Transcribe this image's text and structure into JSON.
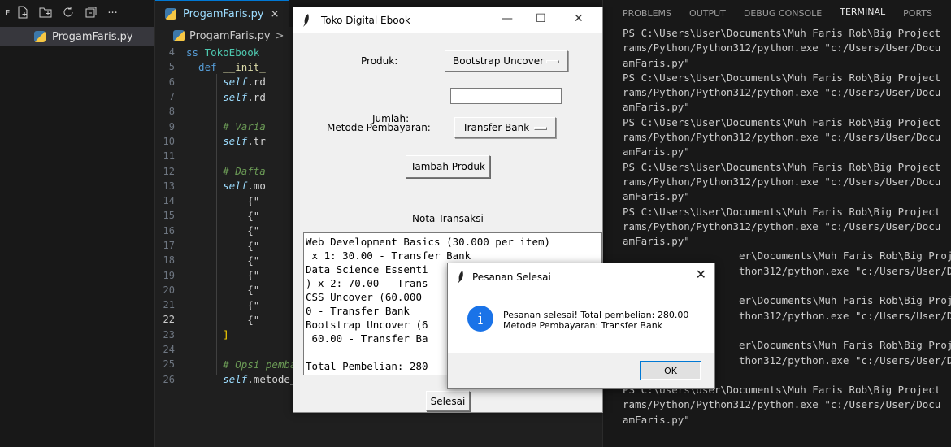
{
  "explorer": {
    "header_letter": "E",
    "file_name": "ProgamFaris.py"
  },
  "editor": {
    "tab_label": "ProgamFaris.py",
    "tab_close": "×",
    "breadcrumb_file": "ProgamFaris.py",
    "breadcrumb_sep": ">",
    "lines": [
      {
        "n": "4",
        "parts": [
          [
            "kw",
            "ss "
          ],
          [
            "cls",
            "TokoEbook"
          ]
        ]
      },
      {
        "n": "5",
        "parts": [
          [
            "kw",
            "  def "
          ],
          [
            "fn",
            "__init_"
          ]
        ]
      },
      {
        "n": "6",
        "parts": [
          [
            "self",
            "      self"
          ],
          [
            "txt",
            "."
          ],
          [
            "txt",
            "rd"
          ]
        ]
      },
      {
        "n": "7",
        "parts": [
          [
            "self",
            "      self"
          ],
          [
            "txt",
            "."
          ],
          [
            "txt",
            "rd"
          ]
        ]
      },
      {
        "n": "8",
        "parts": [
          [
            "txt",
            ""
          ]
        ]
      },
      {
        "n": "9",
        "parts": [
          [
            "cm",
            "      # Varia"
          ]
        ]
      },
      {
        "n": "10",
        "parts": [
          [
            "self",
            "      self"
          ],
          [
            "txt",
            ".tr"
          ]
        ]
      },
      {
        "n": "11",
        "parts": [
          [
            "txt",
            ""
          ]
        ]
      },
      {
        "n": "12",
        "parts": [
          [
            "cm",
            "      # Dafta"
          ]
        ]
      },
      {
        "n": "13",
        "parts": [
          [
            "self",
            "      self"
          ],
          [
            "txt",
            ".mo"
          ]
        ]
      },
      {
        "n": "14",
        "parts": [
          [
            "txt",
            "          {\""
          ]
        ]
      },
      {
        "n": "15",
        "parts": [
          [
            "txt",
            "          {\""
          ]
        ]
      },
      {
        "n": "16",
        "parts": [
          [
            "txt",
            "          {\""
          ]
        ]
      },
      {
        "n": "17",
        "parts": [
          [
            "txt",
            "          {\""
          ]
        ]
      },
      {
        "n": "18",
        "parts": [
          [
            "txt",
            "          {\""
          ]
        ]
      },
      {
        "n": "19",
        "parts": [
          [
            "txt",
            "          {\""
          ]
        ]
      },
      {
        "n": "20",
        "parts": [
          [
            "txt",
            "          {\""
          ]
        ]
      },
      {
        "n": "21",
        "parts": [
          [
            "txt",
            "          {\""
          ]
        ]
      },
      {
        "n": "22",
        "parts": [
          [
            "txt",
            "          {\""
          ]
        ]
      },
      {
        "n": "23",
        "parts": [
          [
            "br",
            "      ]"
          ]
        ]
      },
      {
        "n": "24",
        "parts": [
          [
            "txt",
            ""
          ]
        ]
      },
      {
        "n": "25",
        "parts": [
          [
            "cm",
            "      # Opsi pembayaran"
          ]
        ]
      },
      {
        "n": "26",
        "parts": [
          [
            "self",
            "      self"
          ],
          [
            "txt",
            ".metode_pembayaran = ["
          ]
        ]
      }
    ],
    "current_line": "22"
  },
  "panel": {
    "tabs": [
      "PROBLEMS",
      "OUTPUT",
      "DEBUG CONSOLE",
      "TERMINAL",
      "PORTS"
    ],
    "active_tab": "TERMINAL",
    "terminal_lines": [
      "PS C:\\Users\\User\\Documents\\Muh Faris Rob\\Big Project",
      "rams/Python/Python312/python.exe \"c:/Users/User/Docu",
      "amFaris.py\"",
      "PS C:\\Users\\User\\Documents\\Muh Faris Rob\\Big Project",
      "rams/Python/Python312/python.exe \"c:/Users/User/Docu",
      "amFaris.py\"",
      "PS C:\\Users\\User\\Documents\\Muh Faris Rob\\Big Project",
      "rams/Python/Python312/python.exe \"c:/Users/User/Docu",
      "amFaris.py\"",
      "PS C:\\Users\\User\\Documents\\Muh Faris Rob\\Big Project",
      "rams/Python/Python312/python.exe \"c:/Users/User/Docu",
      "amFaris.py\"",
      "PS C:\\Users\\User\\Documents\\Muh Faris Rob\\Big Project",
      "rams/Python/Python312/python.exe \"c:/Users/User/Docu",
      "amFaris.py\"",
      "                   er\\Documents\\Muh Faris Rob\\Big Project",
      "                   thon312/python.exe \"c:/Users/User/Docu",
      "",
      "                   er\\Documents\\Muh Faris Rob\\Big Project",
      "                   thon312/python.exe \"c:/Users/User/Docu",
      "",
      "                   er\\Documents\\Muh Faris Rob\\Big Project",
      "                   thon312/python.exe \"c:/Users/User/Docu",
      "amFaris.py\"",
      "PS C:\\Users\\User\\Documents\\Muh Faris Rob\\Big Project",
      "rams/Python/Python312/python.exe \"c:/Users/User/Docu",
      "amFaris.py\""
    ]
  },
  "app": {
    "title": "Toko Digital Ebook",
    "produk_label": "Produk:",
    "produk_value": "Bootstrap Uncover",
    "jumlah_label": "Jumlah:",
    "jumlah_value": "",
    "metode_label": "Metode Pembayaran:",
    "metode_value": "Transfer Bank",
    "tambah_button": "Tambah Produk",
    "nota_label": "Nota Transaksi",
    "nota_lines": [
      "Web Development Basics (30.000 per item)",
      " x 1: 30.00 - Transfer Bank",
      "Data Science Essenti",
      ") x 2: 70.00 - Trans",
      "CSS Uncover (60.000",
      "0 - Transfer Bank",
      "Bootstrap Uncover (6",
      " 60.00 - Transfer Ba",
      "",
      "Total Pembelian: 280"
    ],
    "selesai_button": "Selesai"
  },
  "dialog": {
    "title": "Pesanan Selesai",
    "message_line1": "Pesanan selesai! Total pembelian: 280.00",
    "message_line2": "Metode Pembayaran: Transfer Bank",
    "ok_button": "OK",
    "icon": "info-icon"
  },
  "colors": {
    "accent": "#0078d4",
    "info_blue": "#1a73e8"
  }
}
